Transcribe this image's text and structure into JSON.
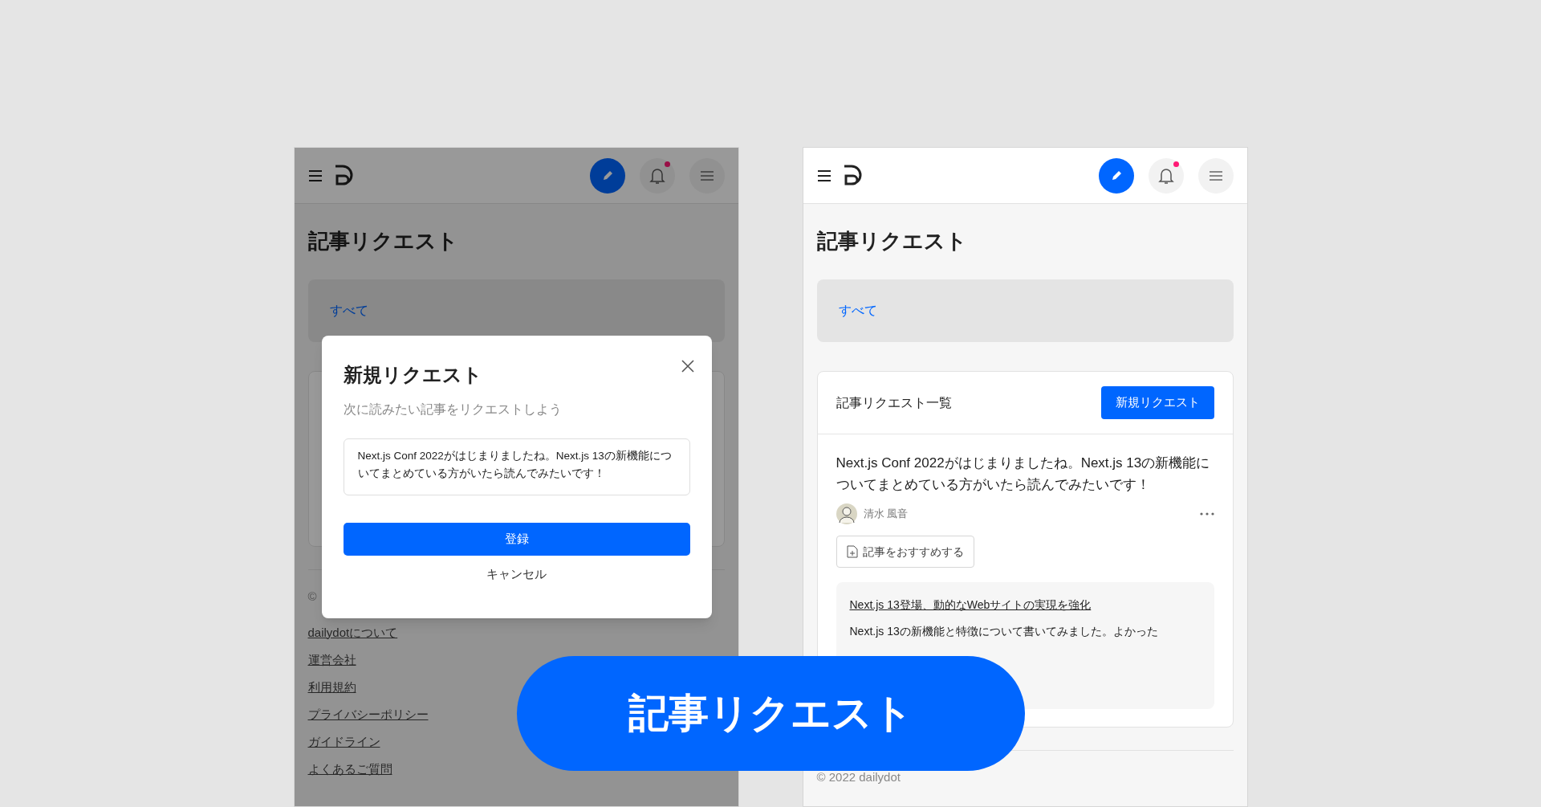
{
  "screens": [
    {
      "kind": "modal",
      "header": {
        "unread": true
      },
      "page_title": "記事リクエスト",
      "filters": [
        {
          "label": "すべて",
          "selected": true
        }
      ],
      "footer": {
        "copyright": "©",
        "links": [
          "dailydotについて",
          "運営会社",
          "利用規約",
          "プライバシーポリシー",
          "ガイドライン",
          "よくあるご質問"
        ]
      },
      "modal": {
        "title": "新規リクエスト",
        "subtitle": "次に読みたい記事をリクエストしよう",
        "value": "Next.js Conf 2022がはじまりましたね。Next.js 13の新機能についてまとめている方がいたら読んでみたいです！",
        "submit": "登録",
        "cancel": "キャンセル"
      }
    },
    {
      "kind": "list",
      "header": {
        "unread": true
      },
      "page_title": "記事リクエスト",
      "filters": [
        {
          "label": "すべて",
          "selected": true
        }
      ],
      "card": {
        "title": "記事リクエスト一覧",
        "new_button": "新規リクエスト",
        "request": {
          "text": "Next.js Conf 2022がはじまりましたね。Next.js 13の新機能についてまとめている方がいたら読んでみたいです！",
          "author": "清水 風音",
          "recommend": "記事をおすすめする",
          "article": {
            "title": "Next.js 13登場、動的なWebサイトの実現を強化",
            "excerpt": "Next.js 13の新機能と特徴について書いてみました。よかった"
          }
        }
      },
      "footer": {
        "copyright": "© 2022 dailydot"
      }
    }
  ],
  "banner": {
    "title": "記事リクエスト"
  }
}
